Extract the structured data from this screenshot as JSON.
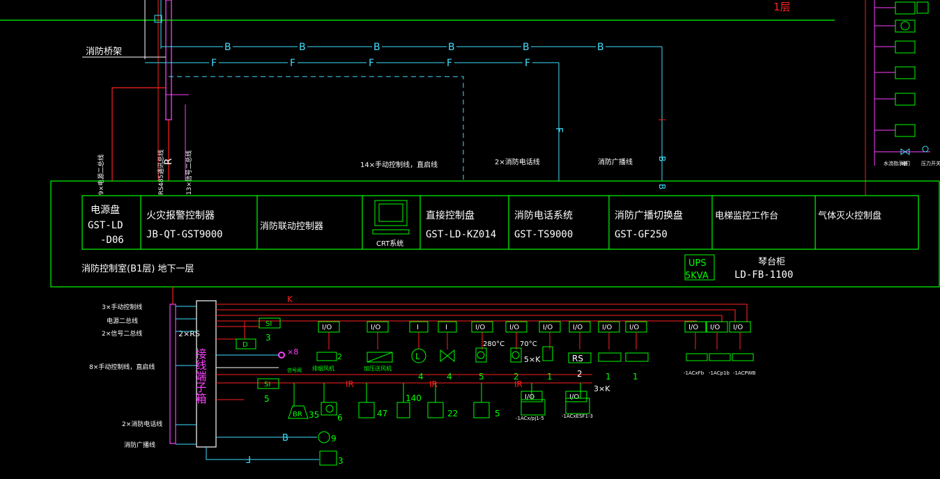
{
  "floor_label": "1层",
  "bridge_label": "消防桥架",
  "bus_letters": {
    "b": "B",
    "f": "F",
    "r": "R",
    "k": "K",
    "ir": "IR",
    "e": "F"
  },
  "vertical_labels": {
    "power_bus": "9×电源二总线",
    "rs485": "RS485通讯总线",
    "signal_bus": "13×信号二总线",
    "b_tag": "B"
  },
  "upper_labels": {
    "manual_line": "14×手动控制线，直启线",
    "phone_line": "2×消防电话线",
    "broadcast_line": "消防广播线"
  },
  "panels": [
    {
      "title": "电源盘",
      "model": "GST-LD",
      "model2": "-D06"
    },
    {
      "title": "火灾报警控制器",
      "model": "JB-QT-GST9000"
    },
    {
      "title": "消防联动控制器",
      "model": ""
    },
    {
      "title": "CRT系统",
      "model": ""
    },
    {
      "title": "直接控制盘",
      "model": "GST-LD-KZ014"
    },
    {
      "title": "消防电话系统",
      "model": "GST-TS9000"
    },
    {
      "title": "消防广播切换盘",
      "model": "GST-GF250"
    },
    {
      "title": "电梯监控工作台",
      "model": ""
    },
    {
      "title": "气体灭火控制盘",
      "model": ""
    }
  ],
  "room_label": "消防控制室(B1层) 地下一层",
  "ups": {
    "line1": "UPS",
    "line2": "5KVA"
  },
  "console": {
    "title": "琴台柜",
    "model": "LD-FB-1100"
  },
  "left_labels": {
    "l1": "3×手动控制线",
    "l2": "电源二总线",
    "l3": "2×信号二总线",
    "l4": "8×手动控制线，直启线",
    "l5": "2×消防电话线",
    "l6": "消防广播线",
    "rs": "2×RS"
  },
  "terminal_box": "接线端子箱",
  "module_labels": {
    "io": "I/O",
    "i": "I",
    "si": "SI",
    "d": "D",
    "rs": "RS"
  },
  "device_texts": {
    "smoke_valve": "排烟风机",
    "fan_start": "加压送风机",
    "x8": "×8",
    "three": "3",
    "five": "5",
    "two": "2",
    "t280": "280°C",
    "t70": "70°C",
    "k5": "5×K",
    "k3": "3×K",
    "n4a": "4",
    "n4b": "4",
    "n5": "5",
    "n2": "2",
    "n1a": "1",
    "n1b": "1",
    "n1c": "1",
    "n35": "35",
    "n6": "6",
    "n47": "47",
    "n140": "140",
    "n22": "22",
    "n5b": "5",
    "n9": "9",
    "n3": "3",
    "ap1": "-1ACx/pj1-5",
    "ap2": "-1ACxESF1-3",
    "ap3": "-1ACxFb",
    "ap4": "-1ACp1b",
    "ap5": "-1ACPWB",
    "valve": "信号阀",
    "pressure": "压力开关",
    "flow": "水流指示器",
    "gate": "闸门",
    "lp": "L"
  },
  "colors": {
    "green": "#00ff00",
    "red": "#ff2020",
    "cyan": "#40e0ff",
    "magenta": "#ff40ff",
    "white": "#ffffff",
    "yellow": "#ffff00",
    "blue": "#4060ff",
    "orange": "#ff7f27"
  }
}
